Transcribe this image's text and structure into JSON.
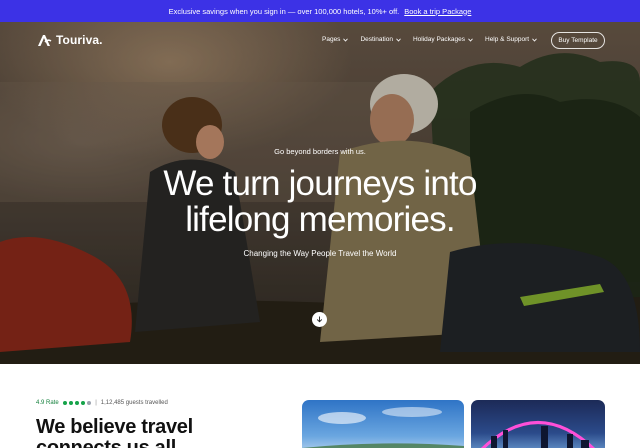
{
  "promo": {
    "text": "Exclusive savings when you sign in — over 100,000 hotels, 10%+ off.",
    "link": "Book a trip Package"
  },
  "nav": {
    "brand": "Touriva.",
    "items": [
      {
        "label": "Pages"
      },
      {
        "label": "Destination"
      },
      {
        "label": "Holiday Packages"
      },
      {
        "label": "Help & Support"
      }
    ],
    "cta": "Buy Template"
  },
  "hero": {
    "eyebrow": "Go beyond borders with us.",
    "headline_line1": "We turn journeys into",
    "headline_line2": "lifelong memories.",
    "subtitle": "Changing the Way People Travel the World"
  },
  "about": {
    "rating_score": "4.9 Rate",
    "rating_separator": "|",
    "rating_count": "1,12,485 guests travelled",
    "title": "We believe travel connects us all"
  },
  "colors": {
    "promo_bg": "#3c32e6",
    "rating_green": "#16a34a"
  },
  "icons": [
    "logo-mark-icon",
    "chevron-down-icon",
    "arrow-down-icon",
    "star-dot-icon"
  ]
}
